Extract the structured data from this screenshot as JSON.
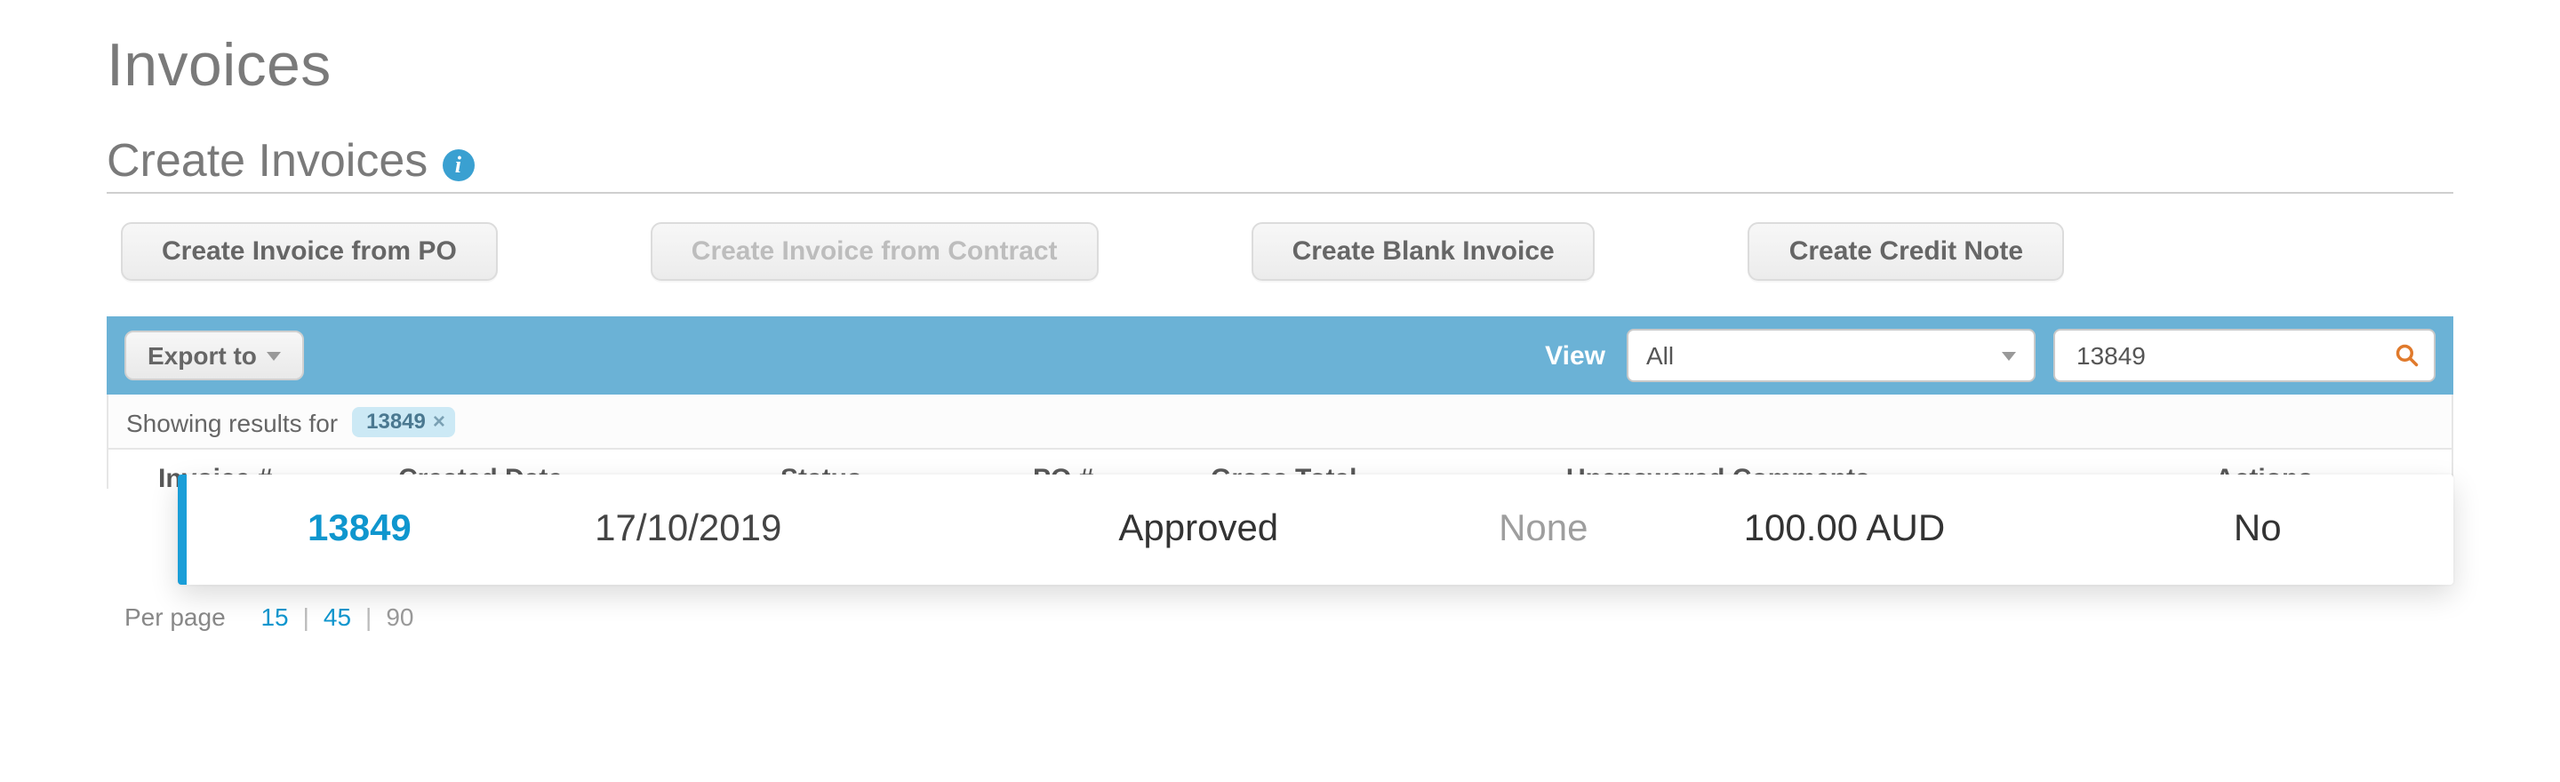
{
  "page": {
    "title": "Invoices",
    "subtitle": "Create Invoices"
  },
  "actions": {
    "create_from_po": "Create Invoice from PO",
    "create_from_contract": "Create Invoice from Contract",
    "create_blank": "Create Blank Invoice",
    "create_credit_note": "Create Credit Note"
  },
  "toolbar": {
    "export_label": "Export to",
    "view_label": "View",
    "view_selected": "All",
    "search_value": "13849"
  },
  "results": {
    "prefix": "Showing results for",
    "chip_value": "13849"
  },
  "columns": {
    "invoice": "Invoice #",
    "created_date": "Created Date",
    "status": "Status",
    "po": "PO #",
    "gross_total": "Gross Total",
    "unanswered": "Unanswered Comments",
    "actions": "Actions"
  },
  "row": {
    "invoice_number": "13849",
    "created_date": "17/10/2019",
    "status": "Approved",
    "po_number": "None",
    "gross_total": "100.00 AUD",
    "unanswered": "No"
  },
  "pager": {
    "label": "Per page",
    "opt1": "15",
    "opt2": "45",
    "opt3": "90"
  },
  "colors": {
    "brand_blue": "#0f96ce",
    "toolbar_blue": "#6bb2d6",
    "chip_bg": "#cce9f5"
  }
}
